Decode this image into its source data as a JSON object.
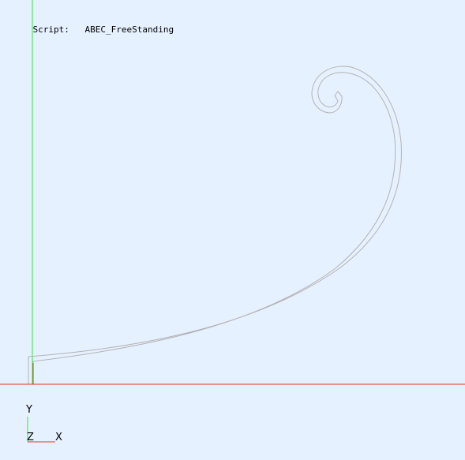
{
  "script": {
    "label": "Script:",
    "value": "ABEC_FreeStanding"
  },
  "axis_triad": {
    "y_label": "Y",
    "z_label": "Z",
    "x_label": "X"
  },
  "colors": {
    "background": "#e6f1ff",
    "x_axis": "#e0322b",
    "y_axis": "#33e63a",
    "profile_outline": "#b3b3b3"
  },
  "scene": {
    "object": "spiral-horn-profile",
    "view": "2D XY"
  }
}
